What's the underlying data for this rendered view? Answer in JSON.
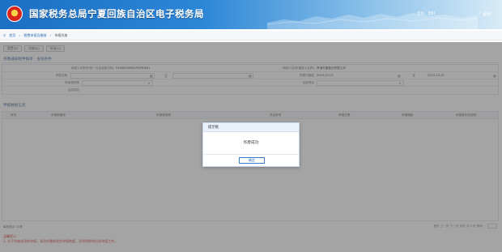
{
  "header": {
    "title": "国家税务总局宁夏回族自治区电子税务局",
    "user_text": "您好，您好",
    "separator": "|",
    "exit_label": "退出"
  },
  "breadcrumb": {
    "home": "首页",
    "level2": "税费申报及缴纳",
    "current": "申报作废"
  },
  "toolbar": {
    "buttons": [
      "重置(R)",
      "作废(D)",
      "关闭(C)"
    ]
  },
  "form": {
    "section_title": "存缴通知税申报单 - 查询条件",
    "row1": {
      "label_a": "纳税人识别号(统一社会信用代码)",
      "value_a": "91640000MA76SPDK81",
      "label_b": "纳税人名称(缴费人名称)",
      "value_b": "青海市秦鑫石有限公司"
    },
    "row2": {
      "label_a": "申报日期",
      "label_b": "所属时期起",
      "value_b": "2019-07-01",
      "label_c": "至",
      "value_c": "2019-12-31"
    },
    "row3": {
      "label_a": "申报表种类",
      "label_b": "征收项目"
    },
    "row4": {
      "label_a": "征收项目"
    }
  },
  "table": {
    "section_title": "申报数据信息",
    "columns": [
      "序号",
      "申报表编号",
      "申报表种类",
      "凭证序号",
      "申报日期",
      "申报期起",
      "申报表状态说明"
    ]
  },
  "pager": {
    "left_text": "每页显示 10条",
    "right_text": "首页  上一页  下一页  末页  共 0 页  跳转"
  },
  "tips": {
    "title": "温馨提示：",
    "line1": "1. 对于作废成功的申报，请及时重新提交申报数据，否则将影响后续申报工作。"
  },
  "dialog": {
    "title": "提示框",
    "message": "作废成功",
    "ok_label": "确定"
  },
  "colors": {
    "header_blue": "#1b6fc4",
    "link_blue": "#2f6fb5",
    "tip_red": "#d0322c",
    "overlay": "#5a5a5a"
  },
  "icons": [
    "emblem-icon",
    "calendar-icon",
    "dropdown-icon"
  ]
}
